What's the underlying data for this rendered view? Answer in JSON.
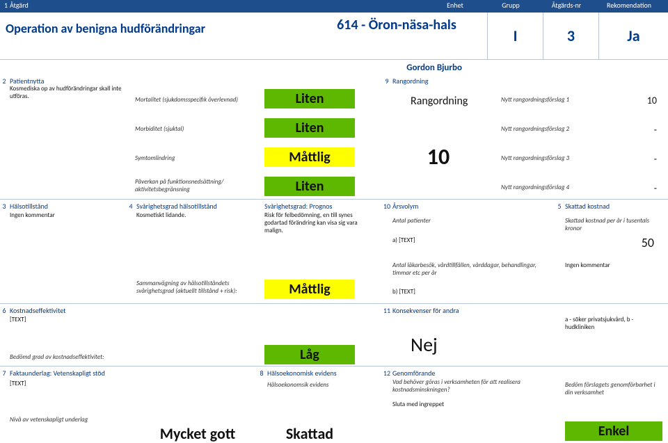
{
  "header": {
    "n1": "1",
    "c1": "Åtgärd",
    "c2": "Enhet",
    "c3": "Grupp",
    "c4": "Åtgärds-nr",
    "c5": "Rekomendation"
  },
  "title": {
    "operation": "Operation av benigna hudförändringar",
    "dept": "614 - Öron-näsa-hals",
    "group": "I",
    "nr": "3",
    "rec": "Ja",
    "author": "Gordon Bjurbo"
  },
  "s2": {
    "n": "2",
    "title": "Patientnytta",
    "desc": "Kosmediska op av hudförändringar skall inte utföras.",
    "rows": {
      "mort": "Mortalitet (sjukdomsspecifik överlevnad)",
      "mortV": "Liten",
      "morb": "Morbiditet (sjuktal)",
      "morbV": "Liten",
      "symt": "Symtomlindring",
      "symtV": "Måttlig",
      "funk": "Påverkan på funktionsnedsättning/ aktivitetsbegränsning",
      "funkV": "Liten"
    }
  },
  "s9": {
    "n": "9",
    "title": "Rangordning",
    "rang": "Rangordning",
    "bigN": "10",
    "r1": "Nytt rangordningsförslag 1",
    "r1v": "10",
    "r2": "Nytt rangordningsförslag 2",
    "r2v": "-",
    "r3": "Nytt rangordningsförslag 3",
    "r3v": "-",
    "r4": "Nytt rangordningsförslag 4",
    "r4v": "-"
  },
  "s3": {
    "n": "3",
    "title": "Hälsotillstånd",
    "desc": "Ingen kommentar"
  },
  "s4": {
    "n": "4",
    "title": "Svårighetsgrad hälsotillstånd",
    "desc": "Kosmetiskt lidande.",
    "progn_t": "Svårighetsgrad: Prognos",
    "progn_d": "Risk för felbedömning, en till synes godartad förändring kan visa sig vara malign.",
    "sam": "Sammanvägning av hälsotillståndets svårighetsgrad (aktuellt tillstånd + risk):",
    "samV": "Måttlig"
  },
  "s10": {
    "n": "10",
    "title": "Årsvolym",
    "ant": "Antal patienter",
    "a": "a) [TEXT]",
    "b": "b) [TEXT]",
    "lak": "Antal läkarbesök, vårdtillfällen, vårddagar, behandlingar, timmar etc per år"
  },
  "s5": {
    "n": "5",
    "title": "Skattad kostnad",
    "sk": "Skattad kostnad per år i tusentals kronor",
    "v": "50",
    "ing": "Ingen kommentar"
  },
  "s6": {
    "n": "6",
    "title": "Kostnadseffektivitet",
    "desc": "[TEXT]",
    "b": "Bedömd grad av kostnadseffektivitet:",
    "val": "Låg"
  },
  "s11": {
    "n": "11",
    "title": "Konsekvenser för andra",
    "big": "Nej",
    "r": "a - söker privatsjukvård, b - hudkliniken"
  },
  "s7": {
    "n": "7",
    "title": "Faktaunderlag: Vetenskapligt stöd",
    "d": "[TEXT]",
    "niv": "Nivå av vetenskapligt underlag",
    "v": "Mycket gott"
  },
  "s8": {
    "n": "8",
    "title": "Hälsoekonomisk evidens",
    "sub": "Hälsoekonomsik evidens",
    "v": "Skattad"
  },
  "s12": {
    "n": "12",
    "title": "Genomförande",
    "q": "Vad behöver göras i verksamheten för att realisera kostnadsminskningen?",
    "a": "Sluta med ingreppet",
    "r": "Bedöm förslagets genomförbarhet i din verksamhet",
    "v": "Enkel"
  }
}
